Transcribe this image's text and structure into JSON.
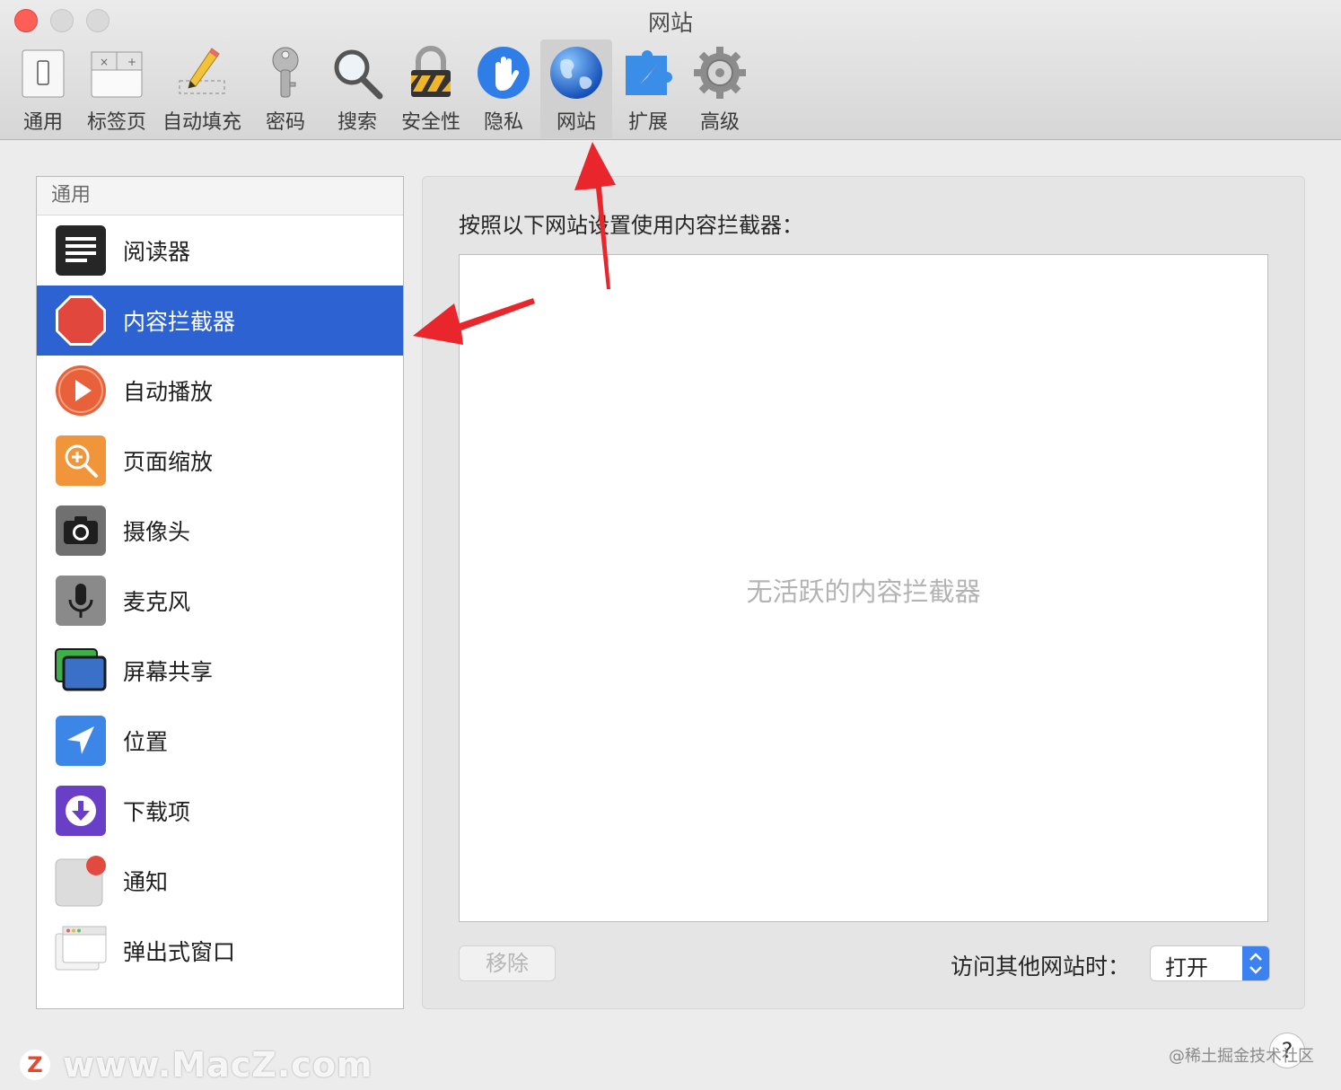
{
  "window": {
    "title": "网站"
  },
  "toolbar": {
    "items": [
      {
        "label": "通用",
        "icon": "general-icon"
      },
      {
        "label": "标签页",
        "icon": "tabs-icon"
      },
      {
        "label": "自动填充",
        "icon": "autofill-pencil-icon"
      },
      {
        "label": "密码",
        "icon": "key-icon"
      },
      {
        "label": "搜索",
        "icon": "magnifier-icon"
      },
      {
        "label": "安全性",
        "icon": "padlock-icon"
      },
      {
        "label": "隐私",
        "icon": "hand-icon"
      },
      {
        "label": "网站",
        "icon": "globe-icon",
        "selected": true
      },
      {
        "label": "扩展",
        "icon": "extension-compass-icon"
      },
      {
        "label": "高级",
        "icon": "gear-icon"
      }
    ]
  },
  "sidebar": {
    "header": "通用",
    "items": [
      {
        "label": "阅读器",
        "icon": "reader-icon"
      },
      {
        "label": "内容拦截器",
        "icon": "stop-sign-icon",
        "selected": true
      },
      {
        "label": "自动播放",
        "icon": "play-icon"
      },
      {
        "label": "页面缩放",
        "icon": "zoom-icon"
      },
      {
        "label": "摄像头",
        "icon": "camera-icon"
      },
      {
        "label": "麦克风",
        "icon": "microphone-icon"
      },
      {
        "label": "屏幕共享",
        "icon": "screen-share-icon"
      },
      {
        "label": "位置",
        "icon": "location-icon"
      },
      {
        "label": "下载项",
        "icon": "download-icon"
      },
      {
        "label": "通知",
        "icon": "notification-icon"
      },
      {
        "label": "弹出式窗口",
        "icon": "popup-window-icon"
      }
    ]
  },
  "panel": {
    "caption": "按照以下网站设置使用内容拦截器：",
    "empty_text": "无活跃的内容拦截器",
    "remove_label": "移除",
    "other_sites_label": "访问其他网站时：",
    "other_sites_value": "打开"
  },
  "footer": {
    "help": "?",
    "watermark_logo": "Z",
    "watermark_left": "www.MacZ.com",
    "watermark_right": "@稀土掘金技术社区"
  },
  "colors": {
    "selection": "#2d62d3",
    "annotation_arrow": "#e8262b",
    "close_button": "#fd5f57"
  }
}
